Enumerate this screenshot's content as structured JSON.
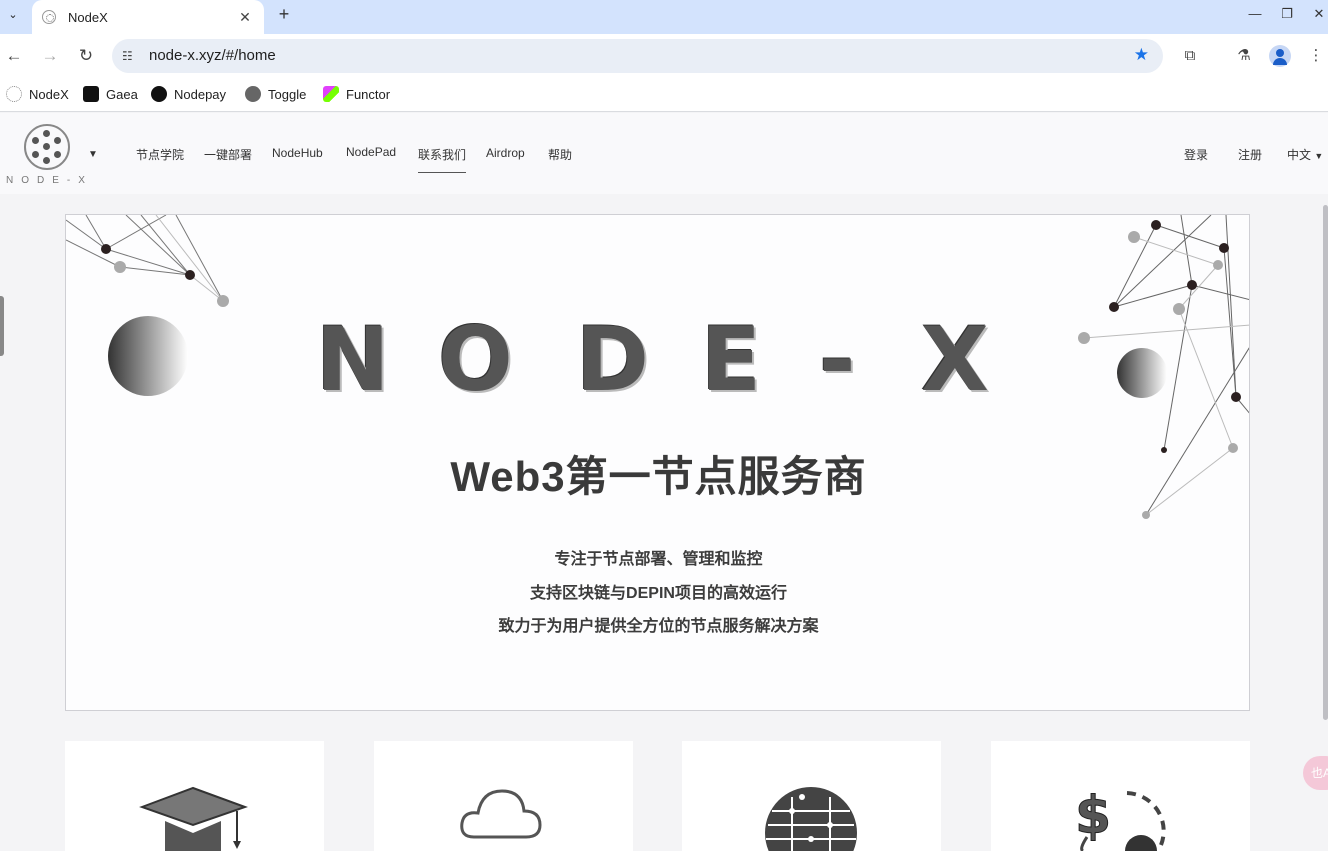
{
  "browser": {
    "tab_title": "NodeX",
    "url": "node-x.xyz/#/home",
    "bookmarks": [
      "NodeX",
      "Gaea",
      "Nodepay",
      "Toggle",
      "Functor"
    ]
  },
  "header": {
    "logo_text": "NODE-X",
    "nav": [
      "节点学院",
      "一键部署",
      "NodeHub",
      "NodePad",
      "联系我们",
      "Airdrop",
      "帮助"
    ],
    "login": "登录",
    "register": "注册",
    "language": "中文"
  },
  "hero": {
    "letters": [
      "N",
      "O",
      "D",
      "E",
      "-",
      "X"
    ],
    "title": "Web3第一节点服务商",
    "lines": [
      "专注于节点部署、管理和监控",
      "支持区块链与DEPIN项目的高效运行",
      "致力于为用户提供全方位的节点服务解决方案"
    ]
  },
  "cards": [
    {
      "icon": "graduation-cap-icon"
    },
    {
      "icon": "cloud-icon"
    },
    {
      "icon": "circuit-brain-icon"
    },
    {
      "icon": "dollar-coin-icon"
    }
  ],
  "floating_badge": "也A",
  "colors": {
    "tabstrip": "#d3e3fd",
    "accent_star": "#1a73e8",
    "page_bg": "#f4f4f6"
  }
}
